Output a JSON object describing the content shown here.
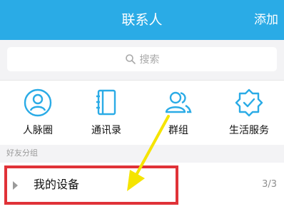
{
  "header": {
    "title": "联系人",
    "add_label": "添加"
  },
  "search": {
    "placeholder": "搜索"
  },
  "quick_entries": [
    {
      "label": "人脉圈",
      "icon": "person-circle-icon"
    },
    {
      "label": "通讯录",
      "icon": "address-book-icon"
    },
    {
      "label": "群组",
      "icon": "group-icon"
    },
    {
      "label": "生活服务",
      "icon": "service-shield-icon"
    }
  ],
  "section": {
    "label": "好友分组"
  },
  "group": {
    "name": "我的设备",
    "count": "3/3"
  },
  "colors": {
    "header_bg": "#2aabe6",
    "icon_blue": "#2aabe6",
    "highlight_red": "#e03238",
    "annotation_yellow": "#f5e400"
  }
}
